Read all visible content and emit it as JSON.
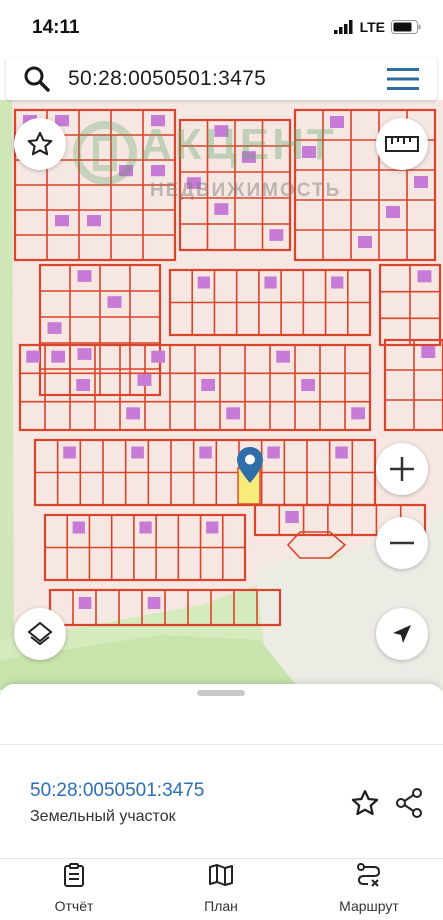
{
  "status": {
    "time": "14:11",
    "network": "LTE"
  },
  "search": {
    "query": "50:28:0050501:3475"
  },
  "watermark": {
    "title": "АКЦЕНТ",
    "subtitle": "НЕДВИЖИМОСТЬ"
  },
  "parcel": {
    "cadastral_number": "50:28:0050501:3475",
    "type": "Земельный участок"
  },
  "tabs": [
    {
      "label": "Отчёт",
      "icon": "report-icon"
    },
    {
      "label": "План",
      "icon": "map-plan-icon"
    },
    {
      "label": "Маршрут",
      "icon": "route-icon"
    }
  ],
  "colors": {
    "accent": "#2b6fb7",
    "parcel_line": "#d9442b",
    "building": "#c77bd6",
    "selected": "#f7ec7a",
    "map_bg": "#f6e7e2",
    "green": "#cfe7b6"
  }
}
